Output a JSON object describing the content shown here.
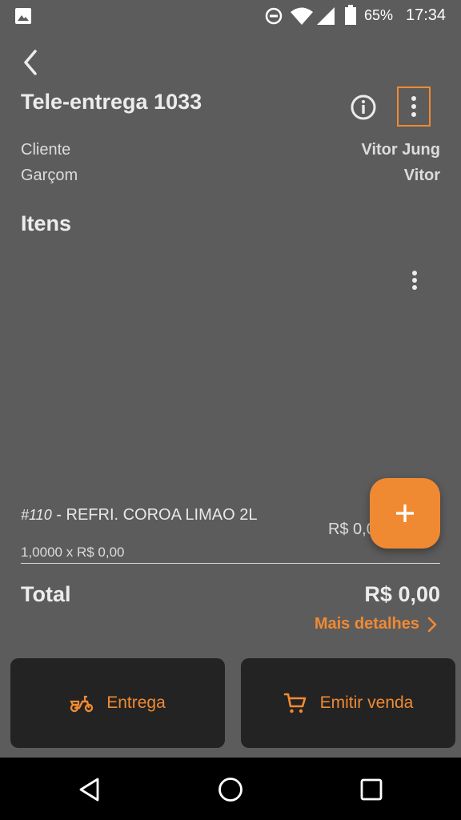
{
  "status_bar": {
    "battery": "65%",
    "time": "17:34",
    "icons": [
      "image-icon",
      "do-not-disturb-icon",
      "wifi-icon",
      "signal-icon",
      "battery-icon"
    ]
  },
  "header": {
    "title": "Tele-entrega 1033",
    "info_icon": "info-icon",
    "menu_icon": "more-vert-icon"
  },
  "order": {
    "client_label": "Cliente",
    "client_value": "Vitor Jung",
    "waiter_label": "Garçom",
    "waiter_value": "Vitor"
  },
  "items_section": {
    "title": "Itens",
    "items": [
      {
        "code": "#110",
        "separator": " - ",
        "name": "REFRI. COROA LIMAO 2L",
        "quantity_line": "1,0000 x R$ 0,00",
        "price": "R$ 0,00"
      }
    ]
  },
  "totals": {
    "label": "Total",
    "value": "R$ 0,00",
    "details_link": "Mais detalhes"
  },
  "actions": {
    "delivery_label": "Entrega",
    "sale_label": "Emitir venda"
  },
  "colors": {
    "accent": "#f08a32",
    "background": "#5c5c5c",
    "button_bg": "#232323"
  }
}
